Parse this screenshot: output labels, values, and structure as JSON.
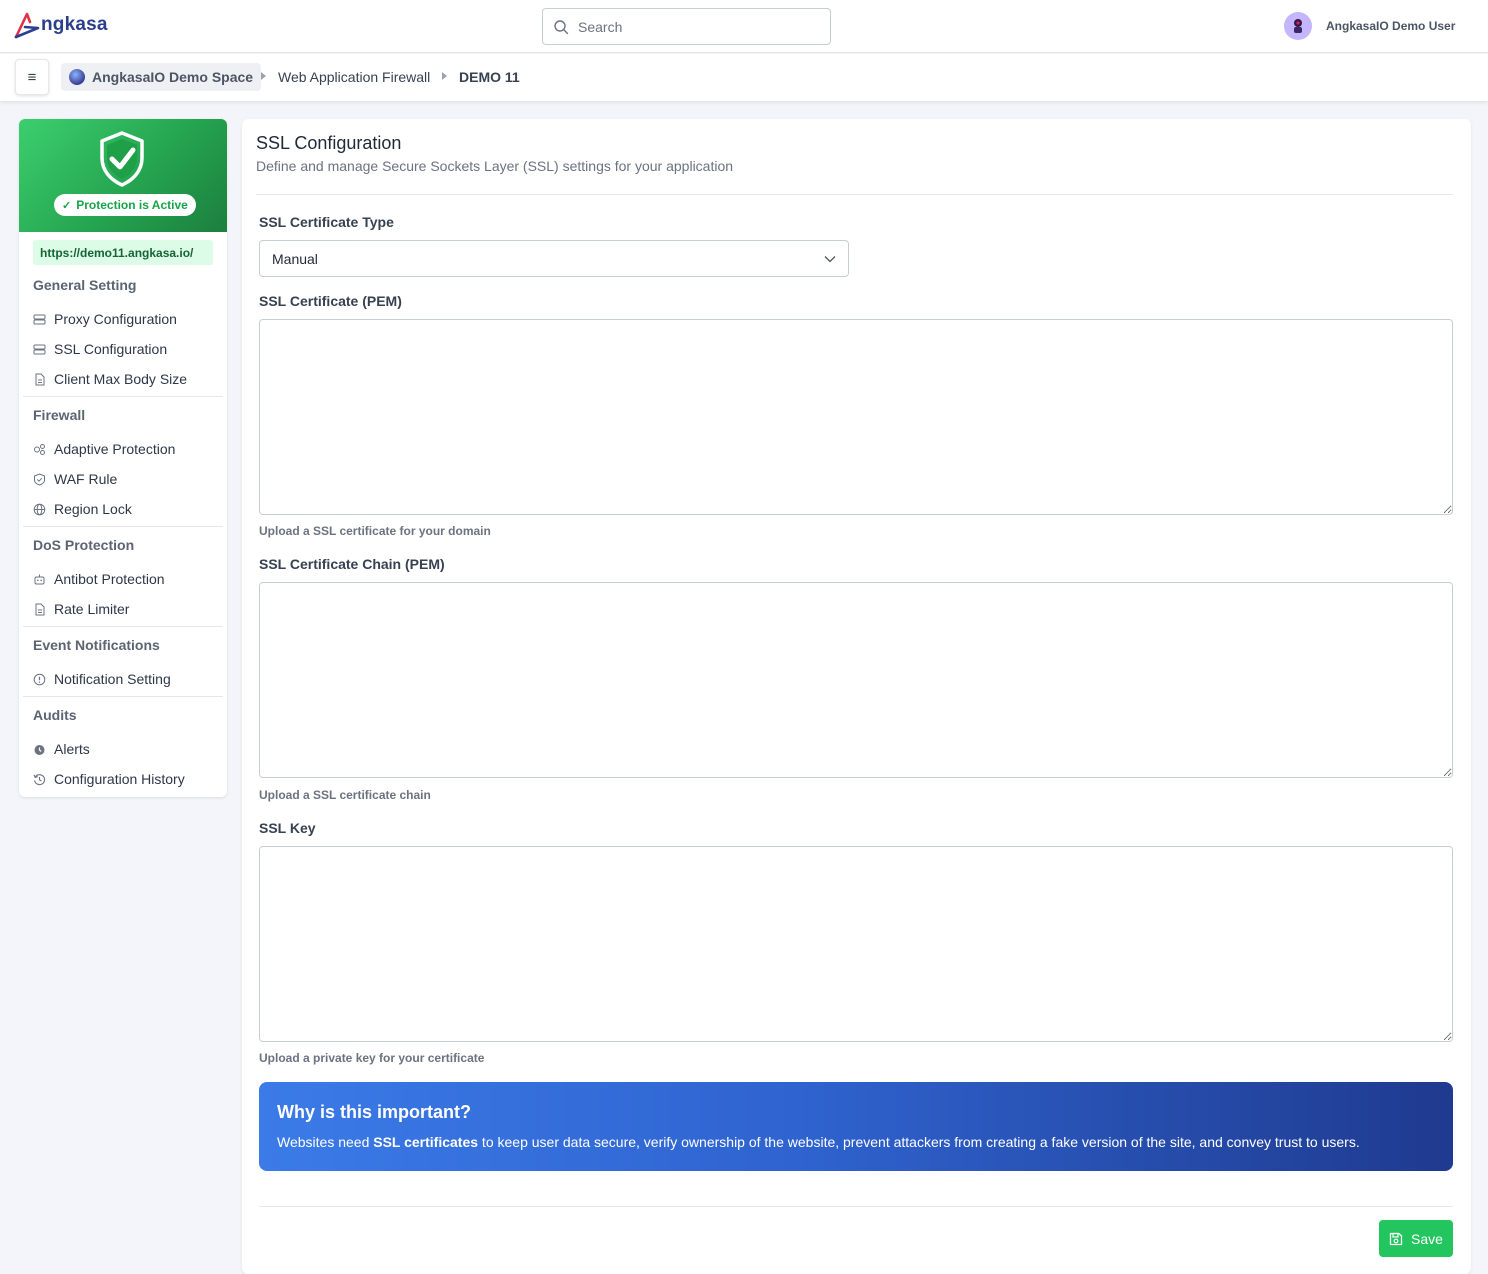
{
  "brand": {
    "name": "ngkasa"
  },
  "search": {
    "placeholder": "Search"
  },
  "user": {
    "name": "AngkasaIO Demo User"
  },
  "breadcrumb": {
    "space": "AngkasaIO Demo Space",
    "section": "Web Application Firewall",
    "current": "DEMO 11"
  },
  "sidebar": {
    "status": "Protection is Active",
    "url": "https://demo11.angkasa.io/",
    "groups": [
      {
        "title": "General Setting",
        "items": [
          {
            "label": "Proxy Configuration",
            "icon": "server-icon"
          },
          {
            "label": "SSL Configuration",
            "icon": "server-icon"
          },
          {
            "label": "Client Max Body Size",
            "icon": "file-icon"
          }
        ]
      },
      {
        "title": "Firewall",
        "items": [
          {
            "label": "Adaptive Protection",
            "icon": "adaptive-icon"
          },
          {
            "label": "WAF Rule",
            "icon": "shield-icon"
          },
          {
            "label": "Region Lock",
            "icon": "globe-icon"
          }
        ]
      },
      {
        "title": "DoS Protection",
        "items": [
          {
            "label": "Antibot Protection",
            "icon": "robot-icon"
          },
          {
            "label": "Rate Limiter",
            "icon": "file-icon"
          }
        ]
      },
      {
        "title": "Event Notifications",
        "items": [
          {
            "label": "Notification Setting",
            "icon": "info-icon"
          }
        ]
      },
      {
        "title": "Audits",
        "items": [
          {
            "label": "Alerts",
            "icon": "alarm-icon"
          },
          {
            "label": "Configuration History",
            "icon": "history-icon"
          }
        ]
      }
    ]
  },
  "main": {
    "title": "SSL Configuration",
    "subtitle": "Define and manage Secure Sockets Layer (SSL) settings for your application",
    "cert_type": {
      "label": "SSL Certificate Type",
      "value": "Manual"
    },
    "cert_pem": {
      "label": "SSL Certificate (PEM)",
      "value": "",
      "help": "Upload a SSL certificate for your domain"
    },
    "cert_chain": {
      "label": "SSL Certificate Chain (PEM)",
      "value": "",
      "help": "Upload a SSL certificate chain"
    },
    "ssl_key": {
      "label": "SSL Key",
      "value": "",
      "help": "Upload a private key for your certificate"
    },
    "info": {
      "title": "Why is this important?",
      "text_before": "Websites need ",
      "text_bold": "SSL certificates",
      "text_after": " to keep user data secure, verify ownership of the website, prevent attackers from creating a fake version of the site, and convey trust to users."
    },
    "save_label": "Save"
  },
  "colors": {
    "accent": "#22c55e",
    "brand": "#2b3f8f",
    "info_gradient_start": "#3b7be8",
    "info_gradient_end": "#1f3a8f"
  }
}
